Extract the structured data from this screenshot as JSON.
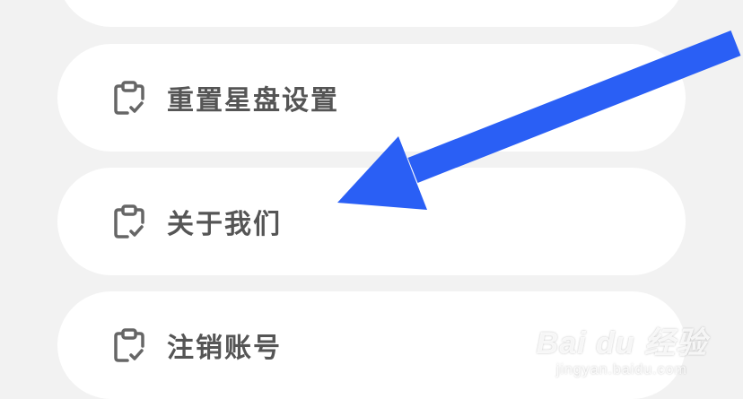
{
  "menu": {
    "items": [
      {
        "label": ""
      },
      {
        "label": "重置星盘设置"
      },
      {
        "label": "关于我们"
      },
      {
        "label": "注销账号"
      }
    ]
  },
  "icon": "clipboard-check-icon",
  "colors": {
    "background": "#f2f2f2",
    "card": "#ffffff",
    "text": "#555555",
    "icon": "#666666",
    "arrow": "#2a5ff5"
  },
  "watermark": {
    "brand": "Bai du 经验",
    "url": "jingyan.baidu.com"
  }
}
